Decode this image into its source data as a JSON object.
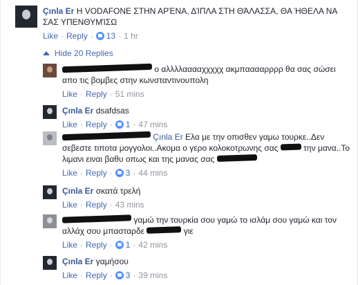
{
  "top_comment": {
    "author": "Çınla Er",
    "text": "Η VODAFONE ΣΤΗΝ ΑΡΈΝΑ, ΔΊΠΛΑ ΣΤΗ ΘΆΛΑΣΣΑ, ΘΑ ΉΘΕΛΑ ΝΑ ΣΑΣ ΥΠΕΝΘΥΜΊΣΩ",
    "like_label": "Like",
    "reply_label": "Reply",
    "likes": "13",
    "time": "1 hr"
  },
  "hide_replies_label": "Hide 20 Replies",
  "replies": [
    {
      "author": "",
      "mention": "",
      "text": "ο αλλλλααααχχχχχ ακμπααααρρρρ θα σας σώσει απο τις βομβες στην κωνσταντινουπολη",
      "like_label": "Like",
      "reply_label": "Reply",
      "likes": "",
      "time": "51 mins"
    },
    {
      "author": "Çınla Er",
      "text": "dsafdsas",
      "like_label": "Like",
      "reply_label": "Reply",
      "likes": "1",
      "time": "47 mins"
    },
    {
      "author": "",
      "mention": "Çınla Er",
      "text_a": "Ελα με την οπισθεν γαμω τουρκε..Δεν σεβεστε τιποτα μογγολοι..Ακομα ο γερο κολοκοτρωνης σας",
      "text_b": "την μανα..Το λιμανι ειναι βαθυ οπως και της μανας σας",
      "like_label": "Like",
      "reply_label": "Reply",
      "likes": "3",
      "time": "44 mins"
    },
    {
      "author": "Çınla Er",
      "text": "σκατά τρελή",
      "like_label": "Like",
      "reply_label": "Reply",
      "likes": "",
      "time": "43 mins"
    },
    {
      "author": "",
      "text_a": "γαμώ την τουρκία σου γαμώ το ισλάμ σου γαμώ και τον αλλάχ σου μπασταρδε",
      "text_b": "γιε",
      "like_label": "Like",
      "reply_label": "Reply",
      "likes": "1",
      "time": "42 mins"
    },
    {
      "author": "Çınla Er",
      "text": "γαμήσου",
      "like_label": "Like",
      "reply_label": "Reply",
      "likes": "3",
      "time": "39 mins"
    }
  ]
}
